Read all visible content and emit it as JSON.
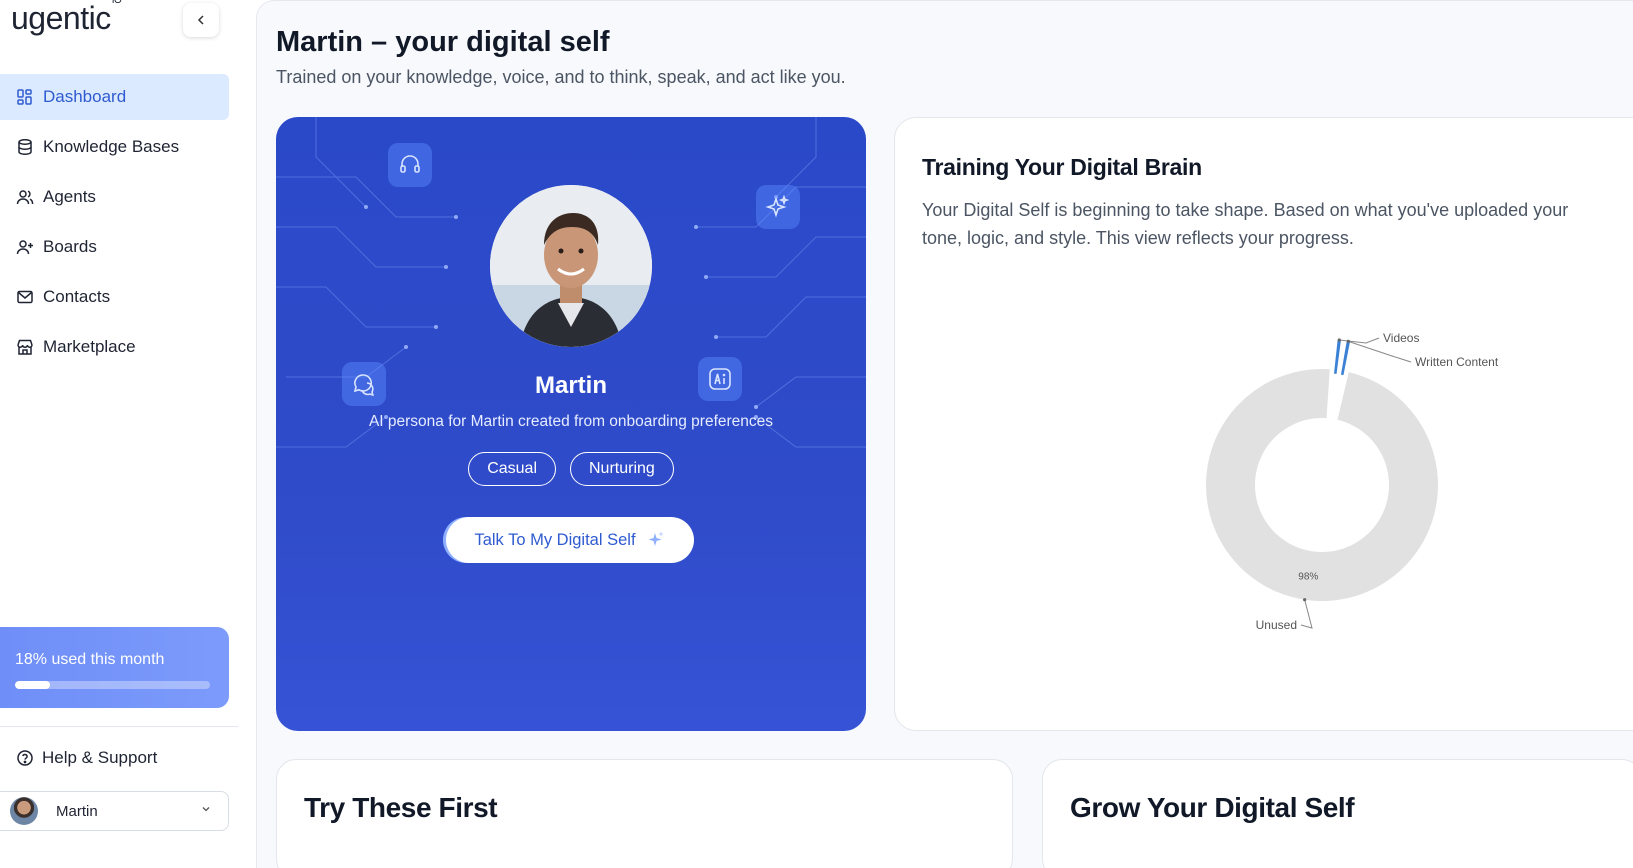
{
  "sidebar": {
    "logo": "ugentic",
    "logo_sup": "IO",
    "collapse_icon": "chevron-left-icon",
    "items": [
      {
        "label": "Dashboard",
        "icon": "dashboard-grid-icon",
        "active": true
      },
      {
        "label": "Knowledge Bases",
        "icon": "database-icon"
      },
      {
        "label": "Agents",
        "icon": "users-icon"
      },
      {
        "label": "Boards",
        "icon": "user-plus-icon"
      },
      {
        "label": "Contacts",
        "icon": "mail-icon"
      },
      {
        "label": "Marketplace",
        "icon": "store-icon"
      }
    ],
    "usage": {
      "text": "18% used this month",
      "percent": 18
    },
    "help": "Help & Support",
    "user": "Martin"
  },
  "header": {
    "title": "Martin – your digital self",
    "subtitle": "Trained on your knowledge, voice, and to think, speak, and act like you."
  },
  "hero": {
    "name": "Martin",
    "description": "AI persona for Martin created from onboarding preferences",
    "tags": [
      "Casual",
      "Nurturing"
    ],
    "cta": "Talk To My Digital Self"
  },
  "brain": {
    "title": "Training Your Digital Brain",
    "description": "Your Digital Self is beginning to take shape. Based on what you've uploaded your tone, logic, and style. This view reflects your progress."
  },
  "chart_data": {
    "type": "pie",
    "donut": true,
    "categories": [
      "Videos",
      "Written Content",
      "Unused"
    ],
    "values": [
      1,
      1,
      98
    ],
    "data_labels": [
      "",
      "",
      "98%"
    ],
    "colors": [
      "#3b82d6",
      "#3b82d6",
      "#e1e1e1"
    ]
  },
  "bottom": {
    "left_title": "Try These First",
    "right_title": "Grow Your Digital Self"
  },
  "colors": {
    "accent": "#2f5bd0",
    "hero": "#2f4bc9",
    "active_bg": "#dbeafe"
  }
}
